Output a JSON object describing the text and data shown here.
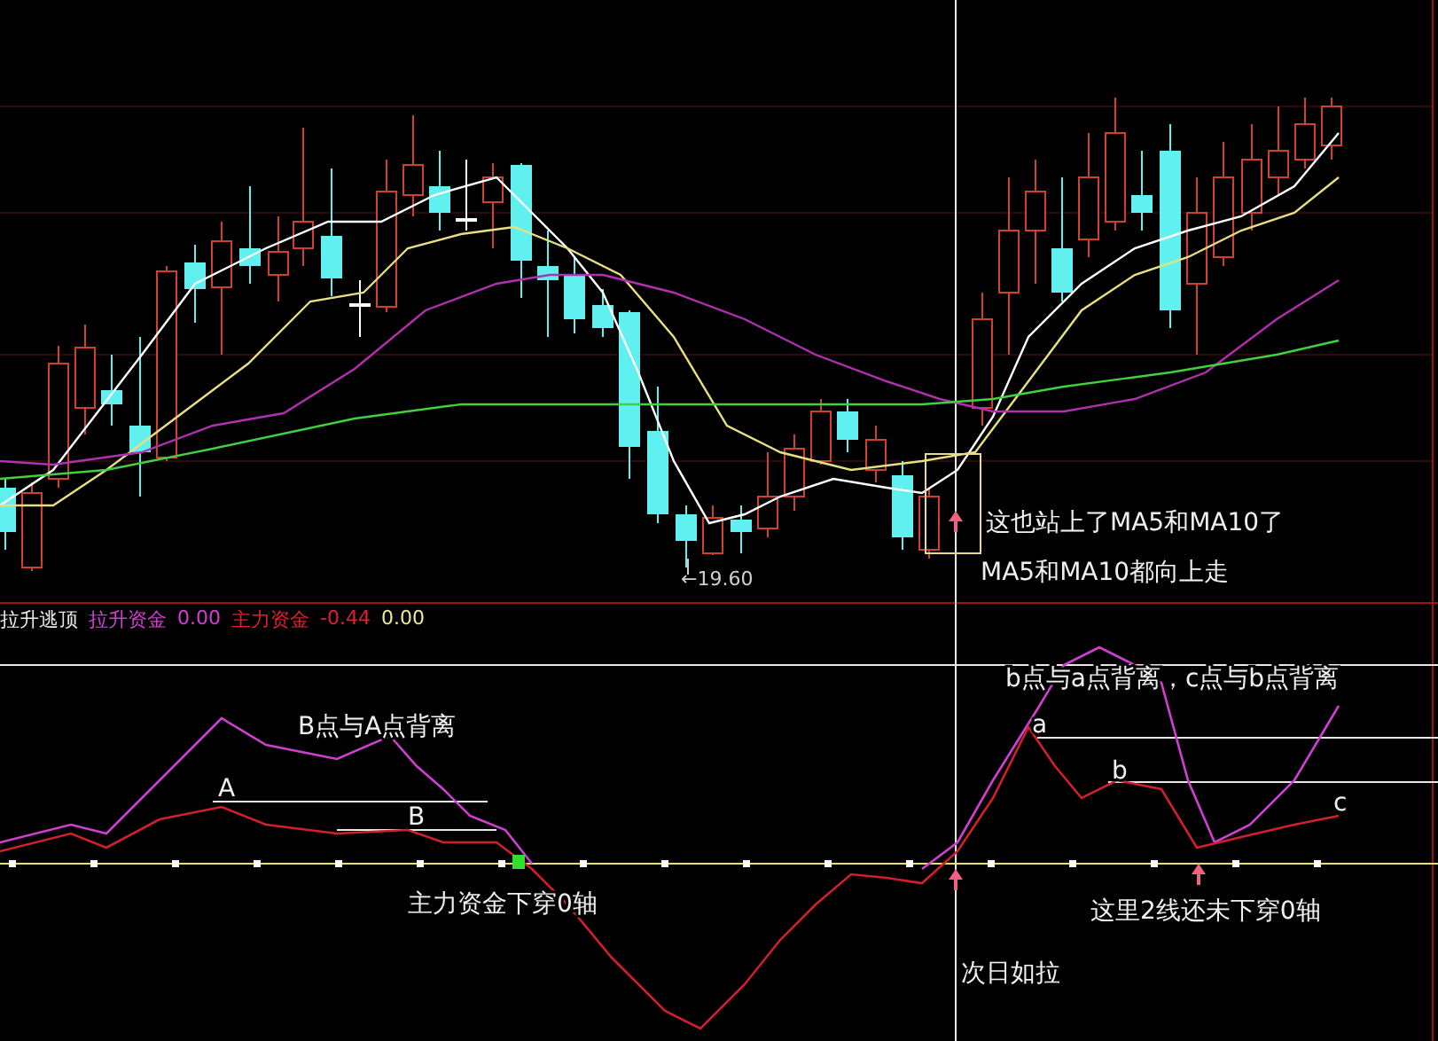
{
  "price_panel": {
    "low_label": "←19.60",
    "annotations": [
      {
        "text": "这也站上了MA5和MA10了"
      },
      {
        "text": "MA5和MA10都向上走"
      }
    ]
  },
  "indicator_panel": {
    "legend": [
      {
        "text": "拉升逃顶",
        "color": "#e8e8e8"
      },
      {
        "text": "拉升资金",
        "color": "#d040d0"
      },
      {
        "text": "0.00",
        "color": "#d040d0"
      },
      {
        "text": "主力资金",
        "color": "#e02030"
      },
      {
        "text": "-0.44",
        "color": "#e02030"
      },
      {
        "text": "0.00",
        "color": "#e8e8a0"
      }
    ],
    "point_labels": [
      "A",
      "B",
      "a",
      "b",
      "c"
    ],
    "notes": [
      {
        "text": "B点与A点背离"
      },
      {
        "text": "主力资金下穿0轴"
      },
      {
        "text": "b点与a点背离，c点与b点背离"
      },
      {
        "text": "这里2线还未下穿0轴"
      },
      {
        "text": "次日如拉"
      }
    ]
  }
}
